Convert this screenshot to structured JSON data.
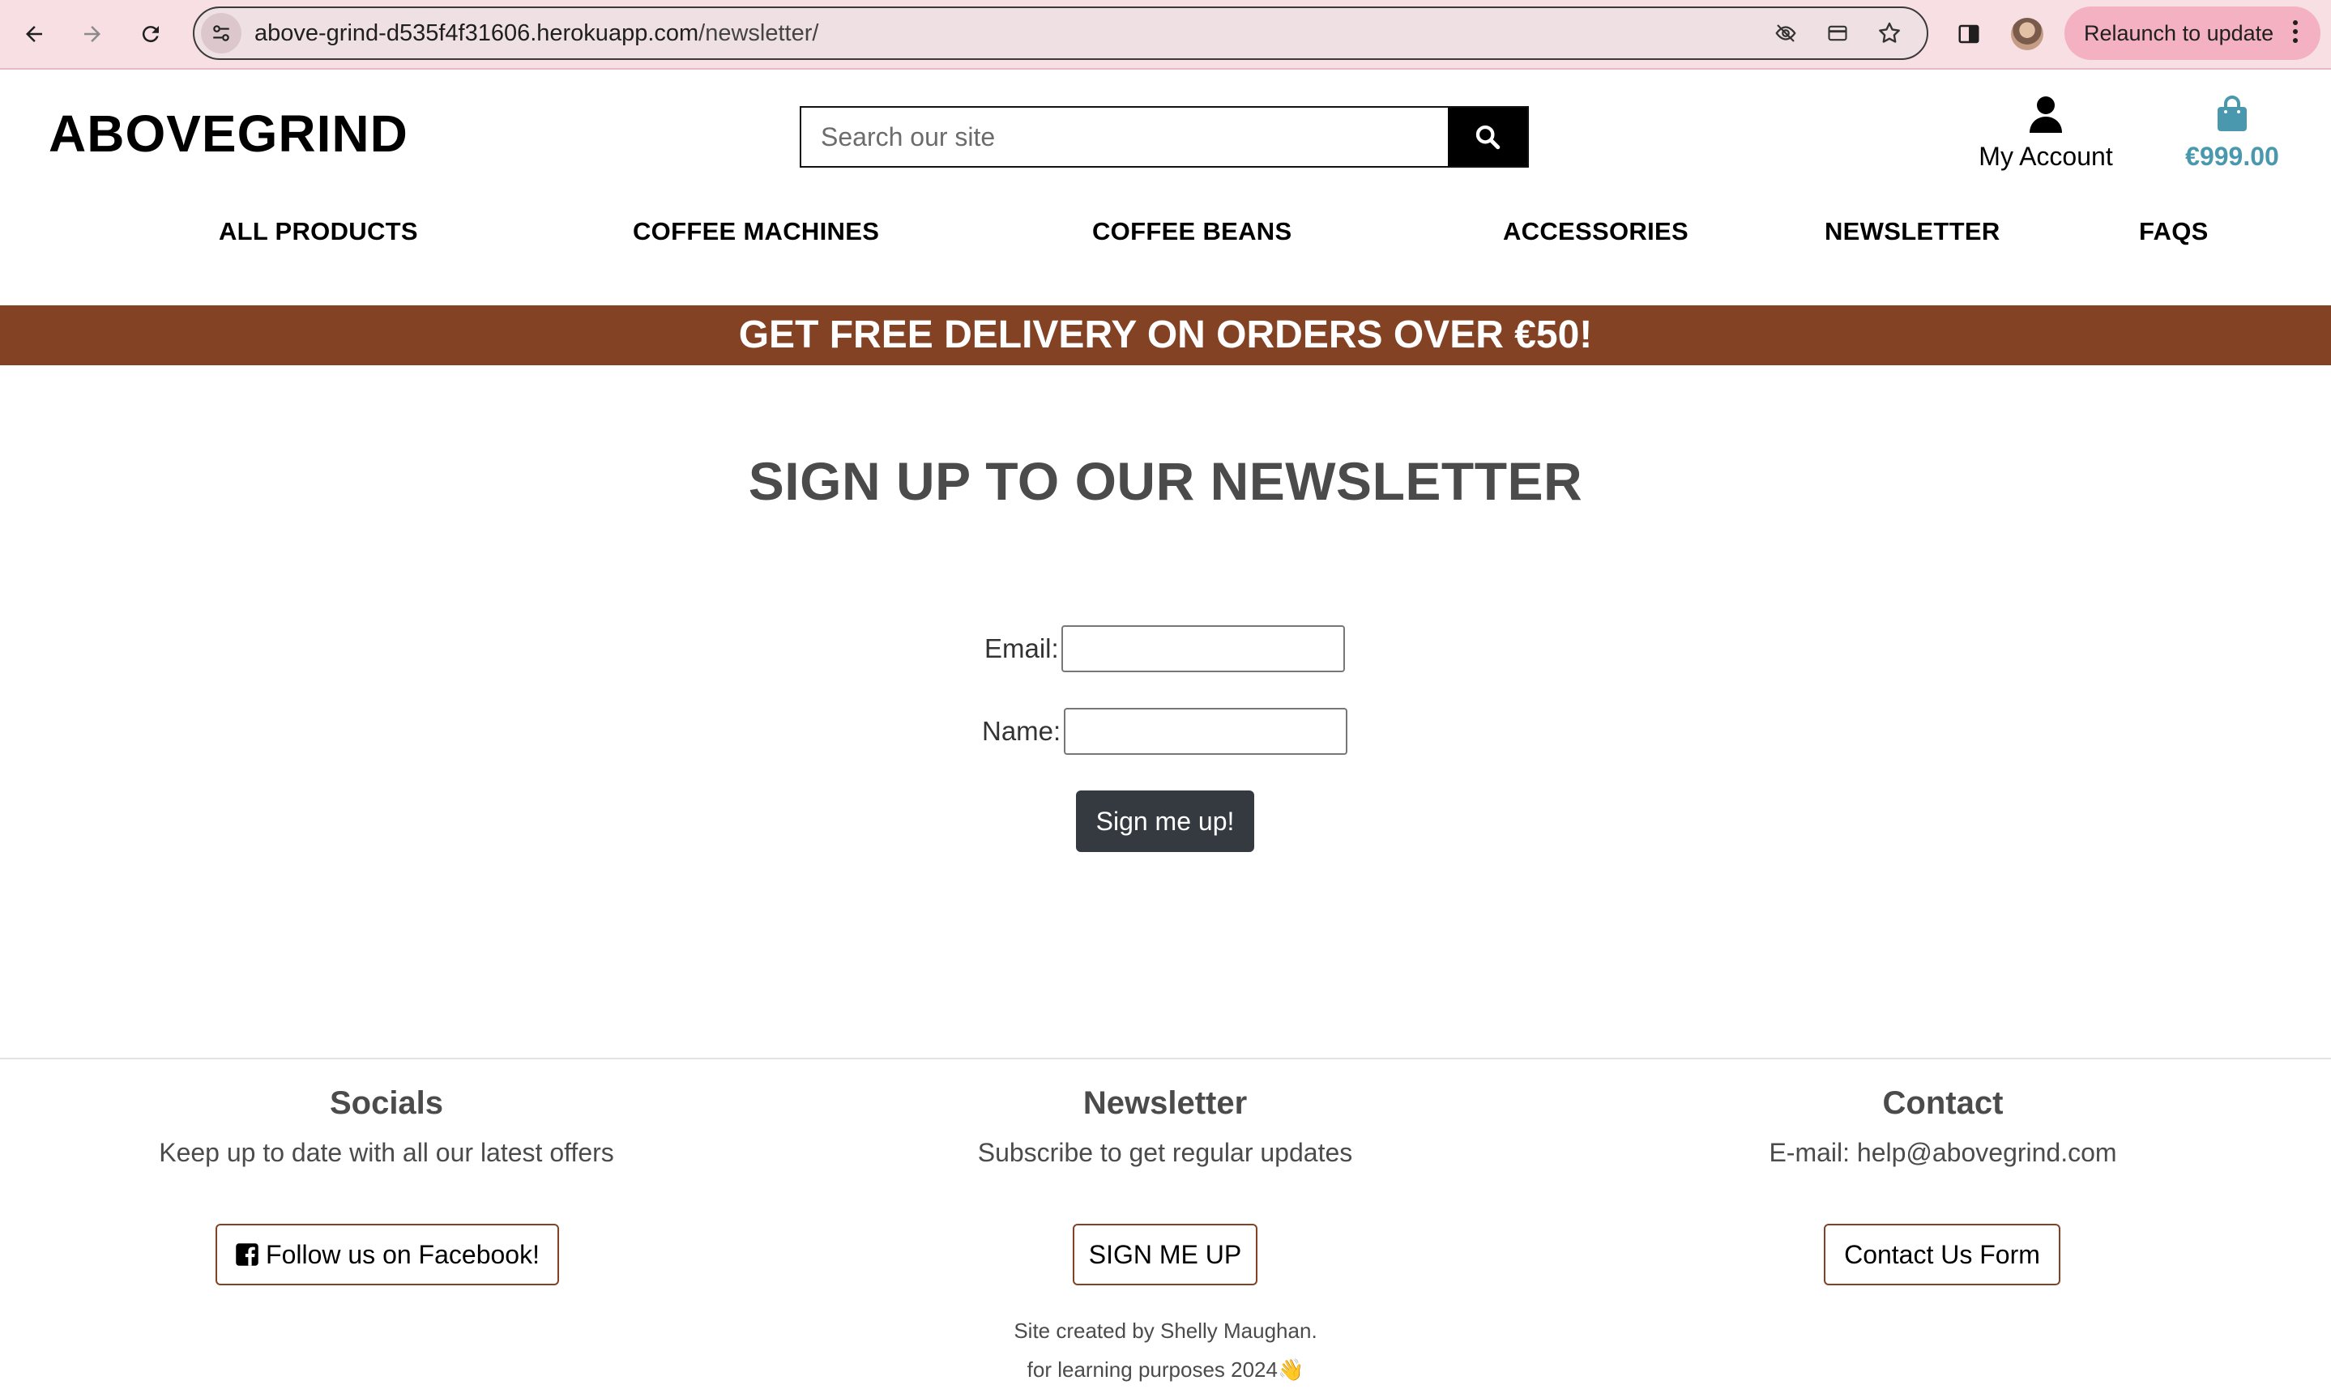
{
  "browser": {
    "url_host": "above-grind-d535f4f31606.herokuapp.com",
    "url_path": "/newsletter/",
    "relaunch_label": "Relaunch to update"
  },
  "header": {
    "logo": "ABOVEGRIND",
    "search_placeholder": "Search our site",
    "account_label": "My Account",
    "bag_total": "€999.00"
  },
  "nav": {
    "items": [
      "ALL PRODUCTS",
      "COFFEE MACHINES",
      "COFFEE BEANS",
      "ACCESSORIES",
      "NEWSLETTER",
      "FAQS"
    ]
  },
  "banner": {
    "text": "GET FREE DELIVERY ON ORDERS OVER €50!"
  },
  "main": {
    "title": "SIGN UP TO OUR NEWSLETTER",
    "email_label": "Email:",
    "name_label": "Name:",
    "submit_label": "Sign me up!"
  },
  "footer": {
    "socials": {
      "heading": "Socials",
      "text": "Keep up to date with all our latest offers",
      "button": "Follow us on Facebook!"
    },
    "newsletter": {
      "heading": "Newsletter",
      "text": "Subscribe to get regular updates",
      "button": "SIGN ME UP"
    },
    "contact": {
      "heading": "Contact",
      "text": "E-mail: help@abovegrind.com",
      "button": "Contact Us Form"
    },
    "credit_line1": "Site created by Shelly Maughan.",
    "credit_line2": "for learning purposes 2024👋"
  },
  "colors": {
    "banner": "#834224",
    "bag_accent": "#4a98ad",
    "chrome": "#f7dfe4",
    "submit_button": "#343a40"
  }
}
